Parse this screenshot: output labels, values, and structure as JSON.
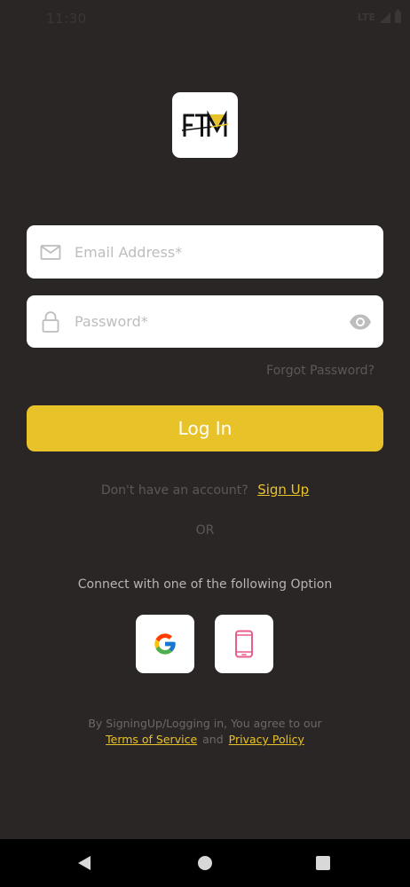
{
  "status_bar": {
    "time": "11:30",
    "network": "LTE"
  },
  "logo": {
    "text": "FTM",
    "accent_color": "#e8c229"
  },
  "form": {
    "email_placeholder": "Email Address*",
    "email_value": "",
    "password_placeholder": "Password*",
    "password_value": "",
    "forgot_label": "Forgot Password?",
    "login_label": "Log In"
  },
  "signup": {
    "prompt": "Don't have an account?",
    "link": "Sign Up"
  },
  "divider": {
    "or": "OR"
  },
  "social": {
    "heading": "Connect with one of the following Option",
    "google_icon": "google-icon",
    "phone_icon": "phone-icon"
  },
  "terms": {
    "prefix": "By SigningUp/Logging in, You agree to our",
    "terms_link": "Terms of Service",
    "and": "and",
    "privacy_link": "Privacy Policy"
  },
  "colors": {
    "background": "#2b2626",
    "accent": "#e8c229",
    "field_bg": "#ffffff"
  }
}
